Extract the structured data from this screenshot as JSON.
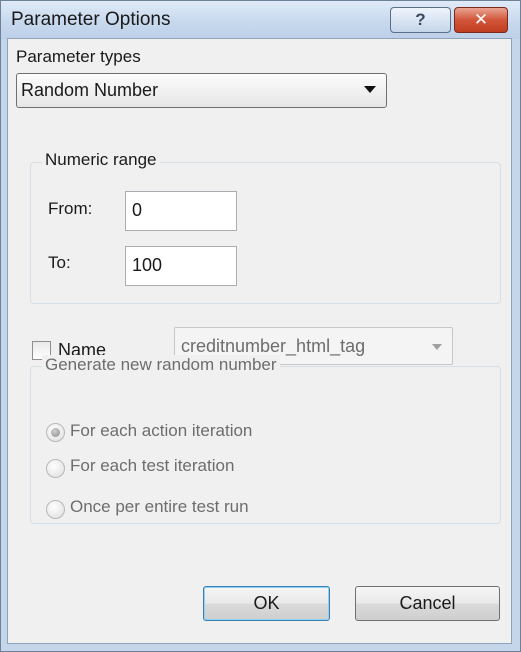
{
  "window": {
    "title": "Parameter Options",
    "help_glyph": "?",
    "close_glyph": "✕"
  },
  "parameter_types": {
    "label": "Parameter types",
    "selected": "Random Number"
  },
  "numeric_range": {
    "title": "Numeric range",
    "from_label": "From:",
    "from_value": "0",
    "to_label": "To:",
    "to_value": "100"
  },
  "name": {
    "checkbox_label": "Name",
    "checked": false,
    "combo_value": "creditnumber_html_tag"
  },
  "generate": {
    "title": "Generate new random number",
    "options": [
      {
        "label": "For each action iteration",
        "checked": true
      },
      {
        "label": "For each test iteration",
        "checked": false
      },
      {
        "label": "Once per entire test run",
        "checked": false
      }
    ]
  },
  "buttons": {
    "ok": "OK",
    "cancel": "Cancel"
  }
}
